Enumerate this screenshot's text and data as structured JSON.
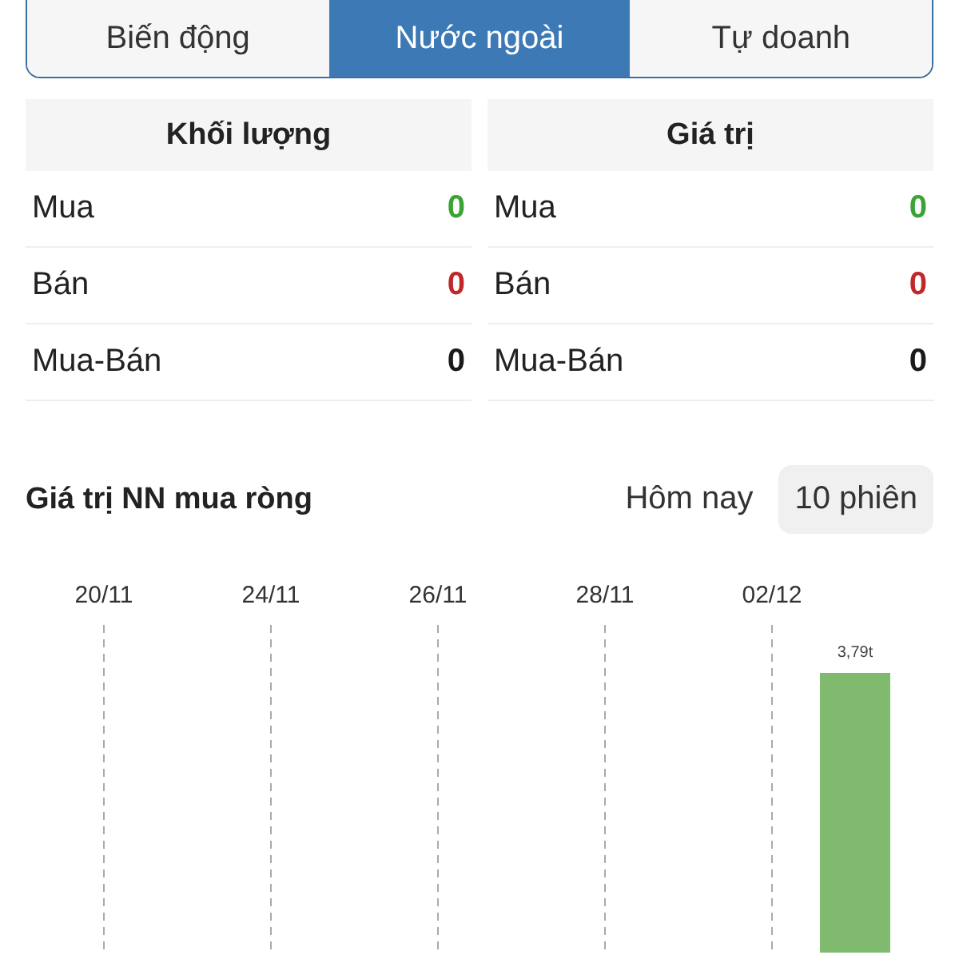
{
  "tabs": [
    {
      "label": "Biến động",
      "selected": false
    },
    {
      "label": "Nước ngoài",
      "selected": true
    },
    {
      "label": "Tự doanh",
      "selected": false
    }
  ],
  "tables": [
    {
      "title": "Khối lượng",
      "rows": [
        {
          "label": "Mua",
          "value": "0",
          "color": "#3aa335"
        },
        {
          "label": "Bán",
          "value": "0",
          "color": "#c0282a"
        },
        {
          "label": "Mua-Bán",
          "value": "0",
          "color": "#1a1a1a"
        }
      ]
    },
    {
      "title": "Giá trị",
      "rows": [
        {
          "label": "Mua",
          "value": "0",
          "color": "#3aa335"
        },
        {
          "label": "Bán",
          "value": "0",
          "color": "#c0282a"
        },
        {
          "label": "Mua-Bán",
          "value": "0",
          "color": "#1a1a1a"
        }
      ]
    }
  ],
  "net_section": {
    "title": "Giá trị NN mua ròng",
    "periods": [
      {
        "label": "Hôm nay",
        "selected": false
      },
      {
        "label": "10 phiên",
        "selected": true
      }
    ],
    "date_labels": [
      "20/11",
      "24/11",
      "26/11",
      "28/11",
      "02/12"
    ],
    "bar_label": "3,79t"
  }
}
